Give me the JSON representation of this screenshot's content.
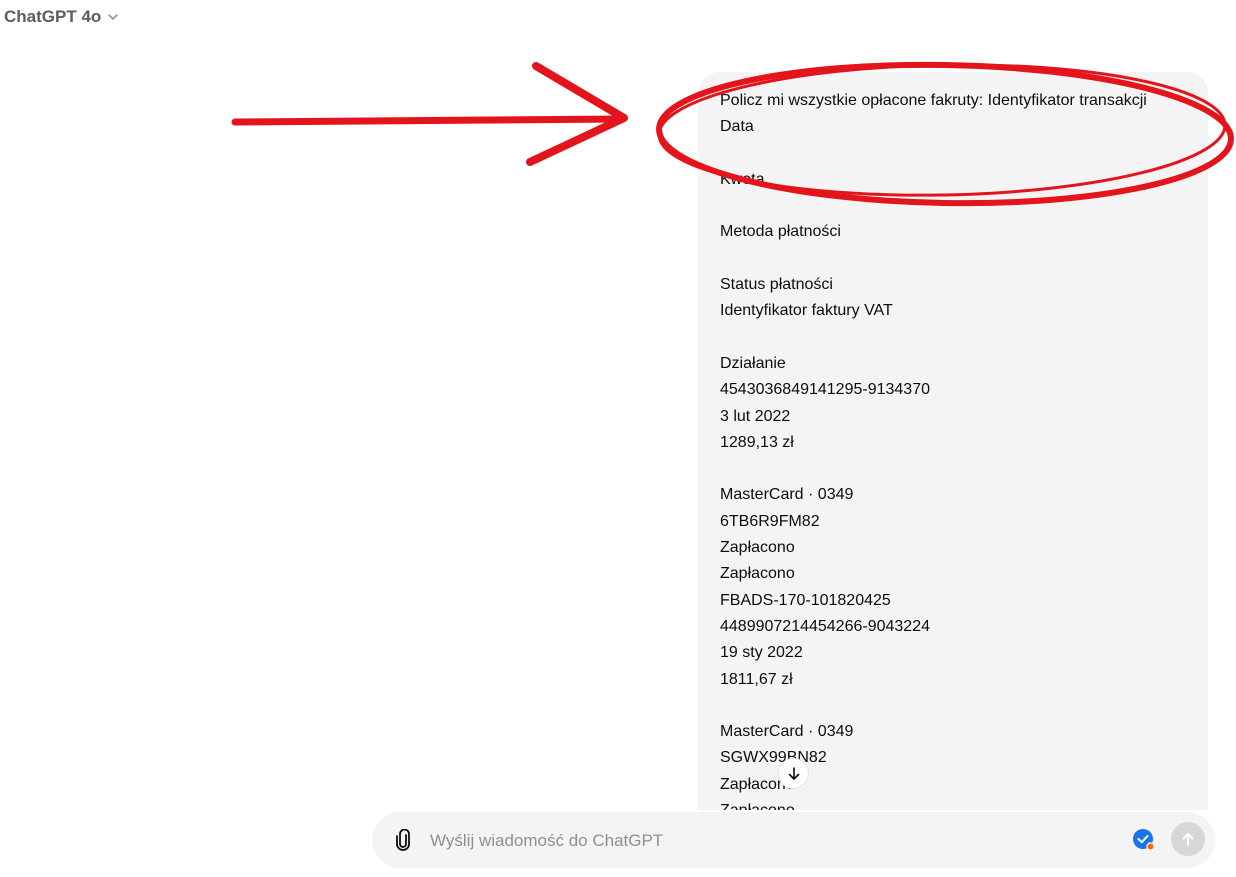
{
  "header": {
    "model_label": "ChatGPT 4o",
    "chevron_icon": "chevron-down-icon"
  },
  "message": {
    "lines": [
      "Policz mi wszystkie opłacone fakruty: Identyfikator transakcji",
      "Data",
      "",
      "Kwota",
      "",
      "Metoda płatności",
      "",
      "Status płatności",
      "Identyfikator faktury VAT",
      "",
      "Działanie",
      "4543036849141295-9134370",
      "3 lut 2022",
      "1289,13 zł",
      "",
      "MasterCard · 0349",
      "6TB6R9FM82",
      "Zapłacono",
      "Zapłacono",
      "FBADS-170-101820425",
      "4489907214454266-9043224",
      "19 sty 2022",
      "1811,67 zł",
      "",
      "MasterCard · 0349",
      "SGWX99BN82",
      "Zapłacono",
      "Zapłacono"
    ]
  },
  "annotation": {
    "color": "#e3141b",
    "shapes": [
      "arrow-right",
      "ellipse"
    ]
  },
  "composer": {
    "placeholder": "Wyślij wiadomość do ChatGPT",
    "attach_icon": "paperclip-icon",
    "grammar_icon": "grammar-check-icon",
    "send_icon": "arrow-up-icon"
  },
  "scroll_button_icon": "arrow-down-icon",
  "colors": {
    "bubble_bg": "#f4f4f4",
    "composer_bg": "#f4f4f4",
    "send_disabled": "#d7d7d7",
    "grammar_blue": "#1a73e8",
    "grammar_dot": "#f26b1d"
  }
}
